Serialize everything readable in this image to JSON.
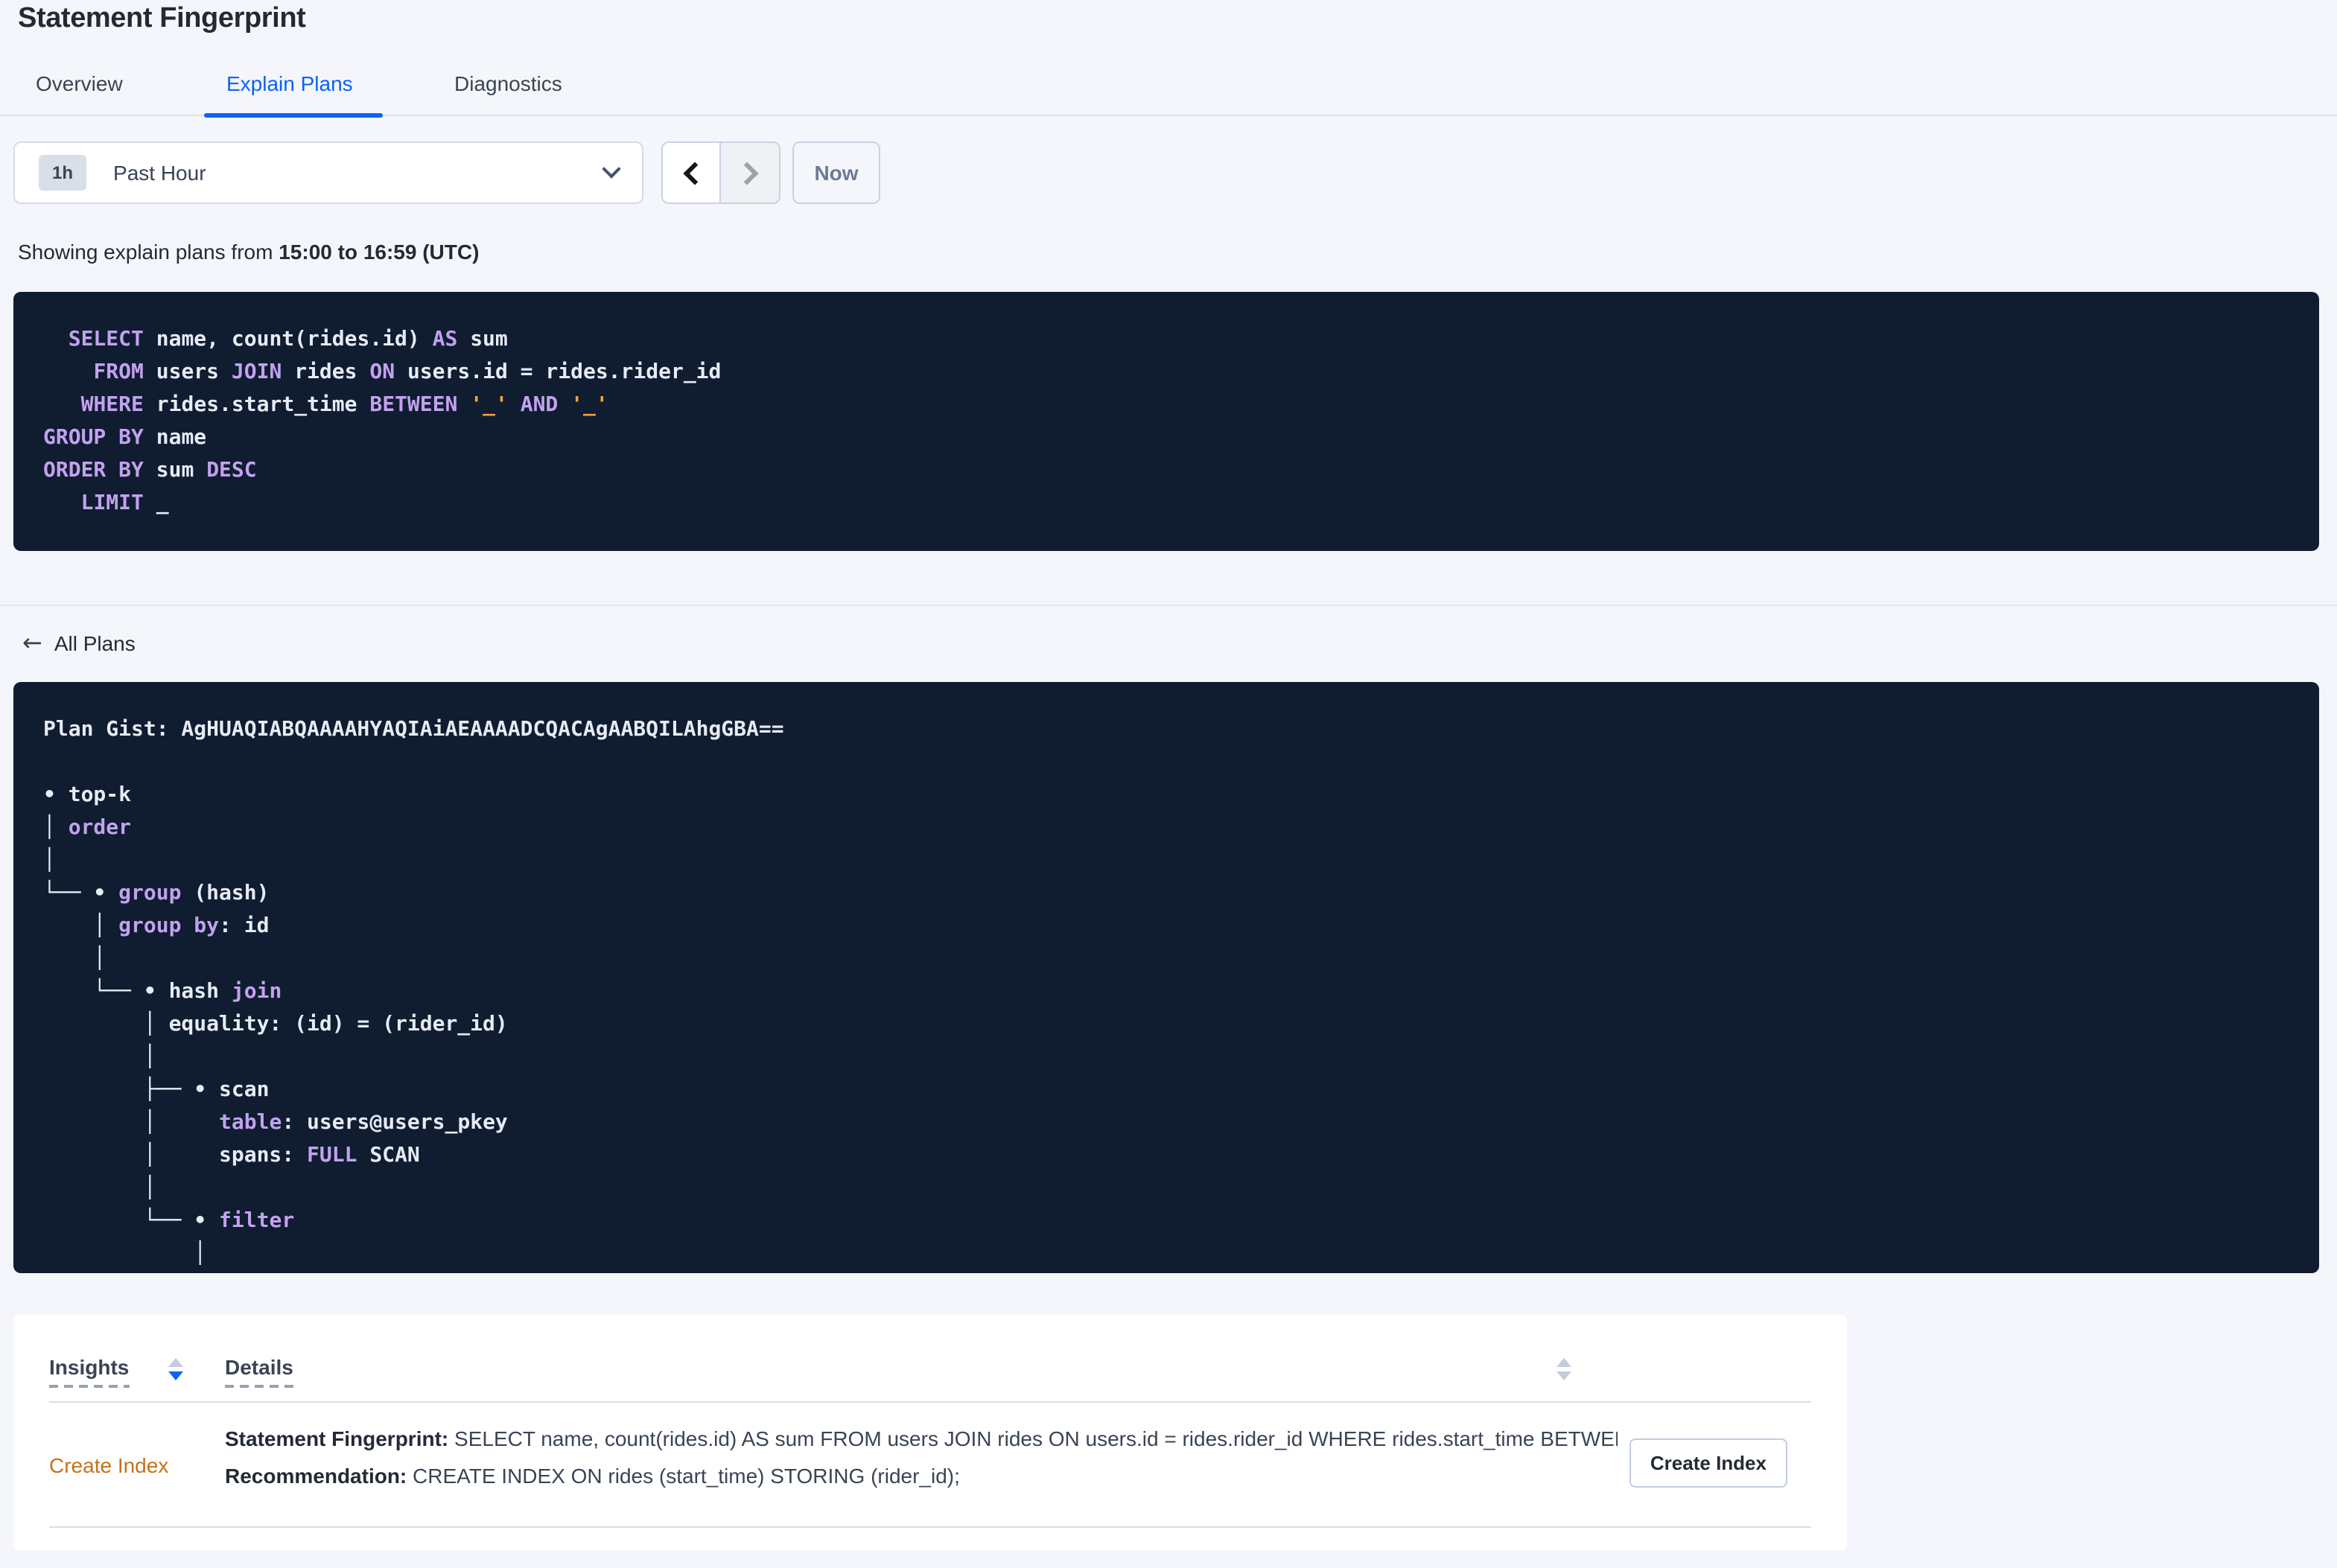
{
  "page": {
    "title": "Statement Fingerprint"
  },
  "tabs": [
    {
      "label": "Overview",
      "active": false
    },
    {
      "label": "Explain Plans",
      "active": true
    },
    {
      "label": "Diagnostics",
      "active": false
    }
  ],
  "time_controls": {
    "interval_badge": "1h",
    "selected_range": "Past Hour",
    "now_label": "Now",
    "prev_icon": "chevron-left",
    "next_icon": "chevron-right",
    "dropdown_icon": "chevron-down",
    "prev_enabled": true,
    "next_enabled": false
  },
  "showing_line": {
    "prefix": "Showing explain plans from ",
    "range": "15:00 to 16:59 (UTC)"
  },
  "sql_statement": {
    "lines": [
      [
        [
          "t",
          "  "
        ],
        [
          "k",
          "SELECT"
        ],
        [
          "t",
          " name, count(rides.id) "
        ],
        [
          "k",
          "AS"
        ],
        [
          "t",
          " sum"
        ]
      ],
      [
        [
          "t",
          "    "
        ],
        [
          "k",
          "FROM"
        ],
        [
          "t",
          " users "
        ],
        [
          "k",
          "JOIN"
        ],
        [
          "t",
          " rides "
        ],
        [
          "k",
          "ON"
        ],
        [
          "t",
          " users.id = rides.rider_id"
        ]
      ],
      [
        [
          "t",
          "   "
        ],
        [
          "k",
          "WHERE"
        ],
        [
          "t",
          " rides.start_time "
        ],
        [
          "k",
          "BETWEEN"
        ],
        [
          "t",
          " "
        ],
        [
          "o",
          "'_'"
        ],
        [
          "t",
          " "
        ],
        [
          "k",
          "AND"
        ],
        [
          "t",
          " "
        ],
        [
          "o",
          "'_'"
        ]
      ],
      [
        [
          "k",
          "GROUP BY"
        ],
        [
          "t",
          " name"
        ]
      ],
      [
        [
          "k",
          "ORDER BY"
        ],
        [
          "t",
          " sum "
        ],
        [
          "k",
          "DESC"
        ]
      ],
      [
        [
          "t",
          "   "
        ],
        [
          "k",
          "LIMIT"
        ],
        [
          "t",
          " _"
        ]
      ]
    ]
  },
  "all_plans": {
    "icon": "←",
    "label": "All Plans"
  },
  "plan": {
    "gist_label": "Plan Gist:",
    "gist": "AgHUAQIABQAAAAHYAQIAiAEAAAADCQACAgAABQILAhgGBA==",
    "lines": [
      [
        [
          "t",
          "Plan Gist: AgHUAQIABQAAAAHYAQIAiAEAAAADCQACAgAABQILAhgGBA=="
        ]
      ],
      [],
      [
        [
          "t",
          "• top-k"
        ]
      ],
      [
        [
          "t",
          "│ "
        ],
        [
          "k",
          "order"
        ]
      ],
      [
        [
          "t",
          "│"
        ]
      ],
      [
        [
          "t",
          "└── • "
        ],
        [
          "k",
          "group"
        ],
        [
          "t",
          " (hash)"
        ]
      ],
      [
        [
          "t",
          "    │ "
        ],
        [
          "k",
          "group by"
        ],
        [
          "t",
          ": id"
        ]
      ],
      [
        [
          "t",
          "    │"
        ]
      ],
      [
        [
          "t",
          "    └── • hash "
        ],
        [
          "k",
          "join"
        ]
      ],
      [
        [
          "t",
          "        │ equality: (id) = (rider_id)"
        ]
      ],
      [
        [
          "t",
          "        │"
        ]
      ],
      [
        [
          "t",
          "        ├── • scan"
        ]
      ],
      [
        [
          "t",
          "        │     "
        ],
        [
          "k",
          "table"
        ],
        [
          "t",
          ": users@users_pkey"
        ]
      ],
      [
        [
          "t",
          "        │     spans: "
        ],
        [
          "k",
          "FULL"
        ],
        [
          "t",
          " SCAN"
        ]
      ],
      [
        [
          "t",
          "        │"
        ]
      ],
      [
        [
          "t",
          "        └── • "
        ],
        [
          "k",
          "filter"
        ]
      ],
      [
        [
          "t",
          "            │"
        ]
      ]
    ]
  },
  "insights_table": {
    "columns": [
      {
        "label": "Insights",
        "sort": "desc"
      },
      {
        "label": "Details",
        "sort": "inactive"
      }
    ],
    "row": {
      "insight": "Create Index",
      "details": [
        {
          "label": "Statement Fingerprint:",
          "value": " SELECT name, count(rides.id) AS sum FROM users JOIN rides ON users.id = rides.rider_id WHERE rides.start_time BETWEEN '_…"
        },
        {
          "label": "Recommendation:",
          "value": " CREATE INDEX ON rides (start_time) STORING (rider_id);"
        }
      ],
      "action_label": "Create Index"
    }
  },
  "colors": {
    "accent-blue": "#0C62F7",
    "keyword-lavender": "#C2A2EE",
    "code-text": "#E6EBF4",
    "placeholder-orange": "#F5A340",
    "insight-orange": "#C77119",
    "code-bg": "#101C30"
  }
}
